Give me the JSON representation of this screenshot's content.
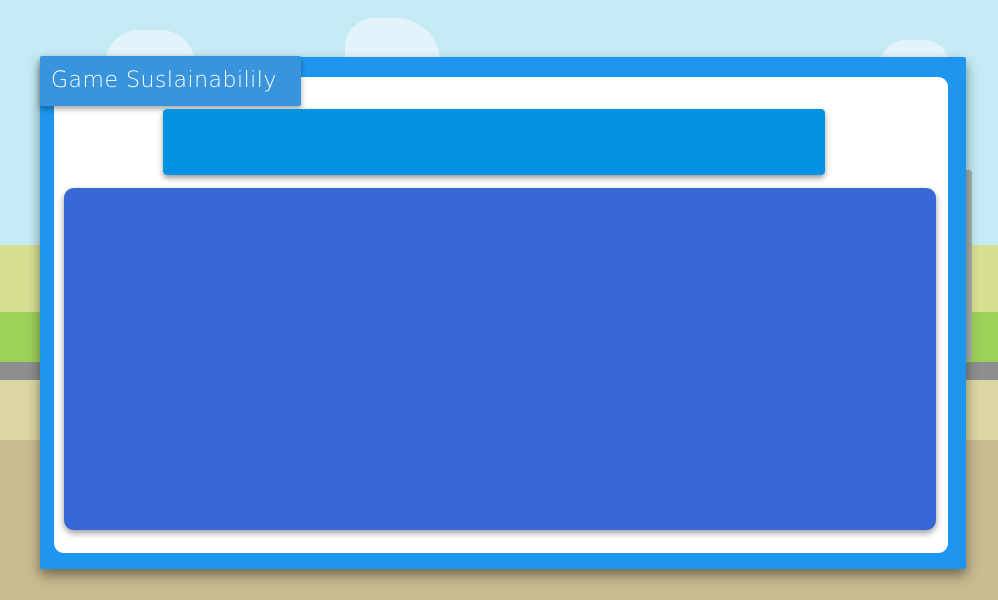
{
  "panel": {
    "title": "Game Suslainabilily",
    "header_text": "",
    "content_text": ""
  },
  "colors": {
    "panel_frame": "#1e96f0",
    "panel_inner": "#ffffff",
    "title_tab": "#3894dc",
    "header_bar": "#0292e3",
    "content_area": "#3867d6",
    "sky": "#c4ebf4"
  }
}
